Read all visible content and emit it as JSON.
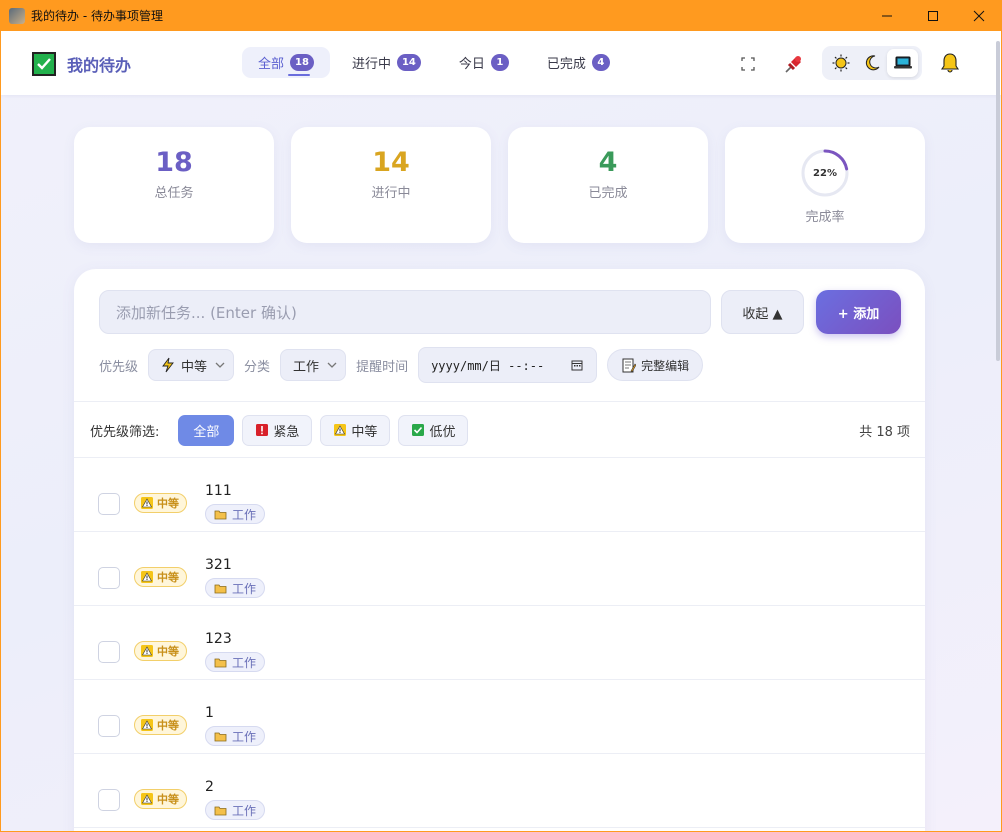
{
  "window": {
    "title": "我的待办 - 待办事项管理"
  },
  "header": {
    "logo_text": "我的待办",
    "tabs": [
      {
        "label": "全部",
        "count": "18",
        "active": true
      },
      {
        "label": "进行中",
        "count": "14",
        "active": false
      },
      {
        "label": "今日",
        "count": "1",
        "active": false
      },
      {
        "label": "已完成",
        "count": "4",
        "active": false
      }
    ],
    "icons": [
      "fullscreen-icon",
      "pin-icon",
      "sun-icon",
      "moon-icon",
      "laptop-icon",
      "bell-icon"
    ],
    "theme_active": "system"
  },
  "stats": {
    "total": {
      "value": "18",
      "label": "总任务",
      "color": "#6b5fc4"
    },
    "in_progress": {
      "value": "14",
      "label": "进行中",
      "color": "#d9a520"
    },
    "done": {
      "value": "4",
      "label": "已完成",
      "color": "#3a9a5a"
    },
    "rate": {
      "value": "22%",
      "percent": 22,
      "label": "完成率",
      "color": "#7b55c0"
    }
  },
  "composer": {
    "placeholder": "添加新任务... (Enter 确认)",
    "collapse_label": "收起 ▲",
    "add_label": "+ 添加",
    "priority_label": "优先级",
    "priority_value": "中等",
    "category_label": "分类",
    "category_value": "工作",
    "reminder_label": "提醒时间",
    "reminder_value": "yyyy/mm/日 --:--",
    "full_edit_label": "完整编辑"
  },
  "filter": {
    "label": "优先级筛选:",
    "chips": [
      {
        "label": "全部",
        "active": true
      },
      {
        "label": "紧急",
        "active": false
      },
      {
        "label": "中等",
        "active": false
      },
      {
        "label": "低优",
        "active": false
      }
    ],
    "count_text": "共 18 项"
  },
  "tasks": [
    {
      "title": "111",
      "priority": "中等",
      "category": "工作"
    },
    {
      "title": "321",
      "priority": "中等",
      "category": "工作"
    },
    {
      "title": "123",
      "priority": "中等",
      "category": "工作"
    },
    {
      "title": "1",
      "priority": "中等",
      "category": "工作"
    },
    {
      "title": "2",
      "priority": "中等",
      "category": "工作"
    }
  ],
  "colors": {
    "accent": "#6b5fc4",
    "titlebar": "#ff9a1f",
    "warning": "#f2c21a"
  }
}
